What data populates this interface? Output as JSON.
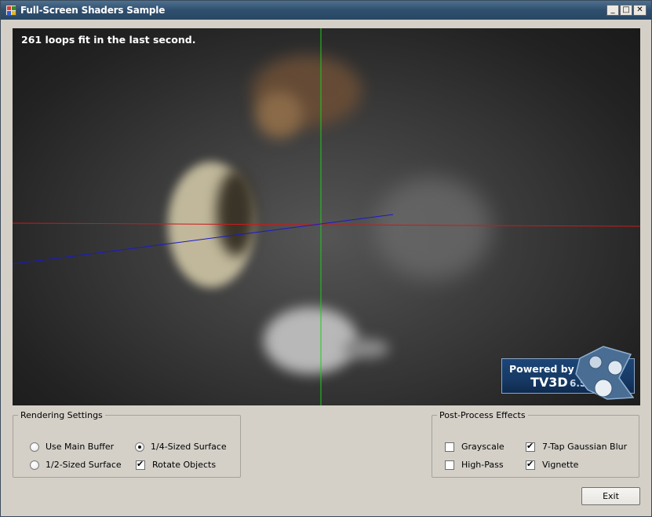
{
  "window": {
    "title": "Full-Screen Shaders Sample",
    "controls": {
      "minimize": "_",
      "maximize": "□",
      "close": "✕"
    }
  },
  "viewport": {
    "status_text": "261 loops fit in the last second.",
    "badge": {
      "line1": "Powered by",
      "line2": "TV3D",
      "version": "6.5"
    }
  },
  "rendering_settings": {
    "legend": "Rendering Settings",
    "options": [
      {
        "label": "Use Main Buffer",
        "type": "radio",
        "checked": false
      },
      {
        "label": "1/4-Sized Surface",
        "type": "radio",
        "checked": true
      },
      {
        "label": "1/2-Sized Surface",
        "type": "radio",
        "checked": false
      },
      {
        "label": "Rotate Objects",
        "type": "checkbox",
        "checked": true
      }
    ]
  },
  "post_process": {
    "legend": "Post-Process Effects",
    "options": [
      {
        "label": "Grayscale",
        "checked": false
      },
      {
        "label": "7-Tap Gaussian Blur",
        "checked": true
      },
      {
        "label": "High-Pass",
        "checked": false
      },
      {
        "label": "Vignette",
        "checked": true
      }
    ]
  },
  "exit_label": "Exit",
  "colors": {
    "axis_x": "#cc1a1a",
    "axis_y": "#1ecc1e",
    "axis_z": "#1a1acc",
    "badge_bg": "#1c4576"
  }
}
